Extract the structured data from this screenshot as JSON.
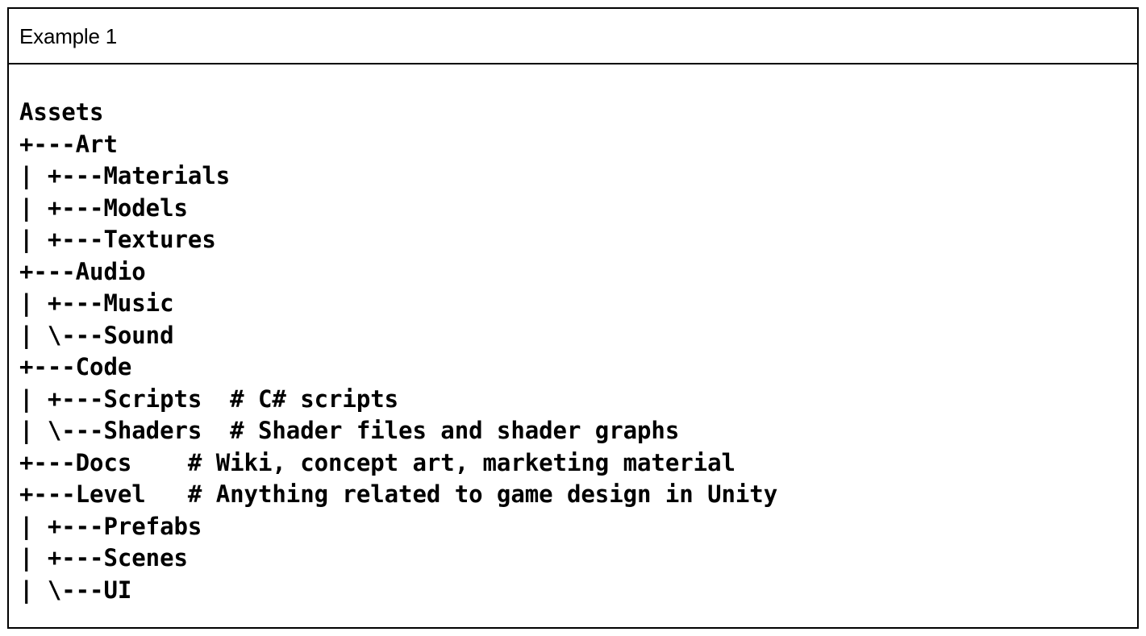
{
  "example": {
    "header": {
      "title": "Example 1"
    },
    "code_block": {
      "language": "text",
      "lines": [
        "Assets",
        "+---Art",
        "| +---Materials",
        "| +---Models",
        "| +---Textures",
        "+---Audio",
        "| +---Music",
        "| \\---Sound",
        "+---Code",
        "| +---Scripts  # C# scripts",
        "| \\---Shaders  # Shader files and shader graphs",
        "+---Docs    # Wiki, concept art, marketing material",
        "+---Level   # Anything related to game design in Unity",
        "| +---Prefabs",
        "| +---Scenes",
        "| \\---UI"
      ],
      "full_text": "Assets\n+---Art\n| +---Materials\n| +---Models\n| +---Textures\n+---Audio\n| +---Music\n| \\---Sound\n+---Code\n| +---Scripts  # C# scripts\n| \\---Shaders  # Shader files and shader graphs\n+---Docs    # Wiki, concept art, marketing material\n+---Level   # Anything related to game design in Unity\n| +---Prefabs\n| +---Scenes\n| \\---UI"
    }
  },
  "colors": {
    "border": "#000000",
    "text": "#000000",
    "background": "#ffffff"
  }
}
